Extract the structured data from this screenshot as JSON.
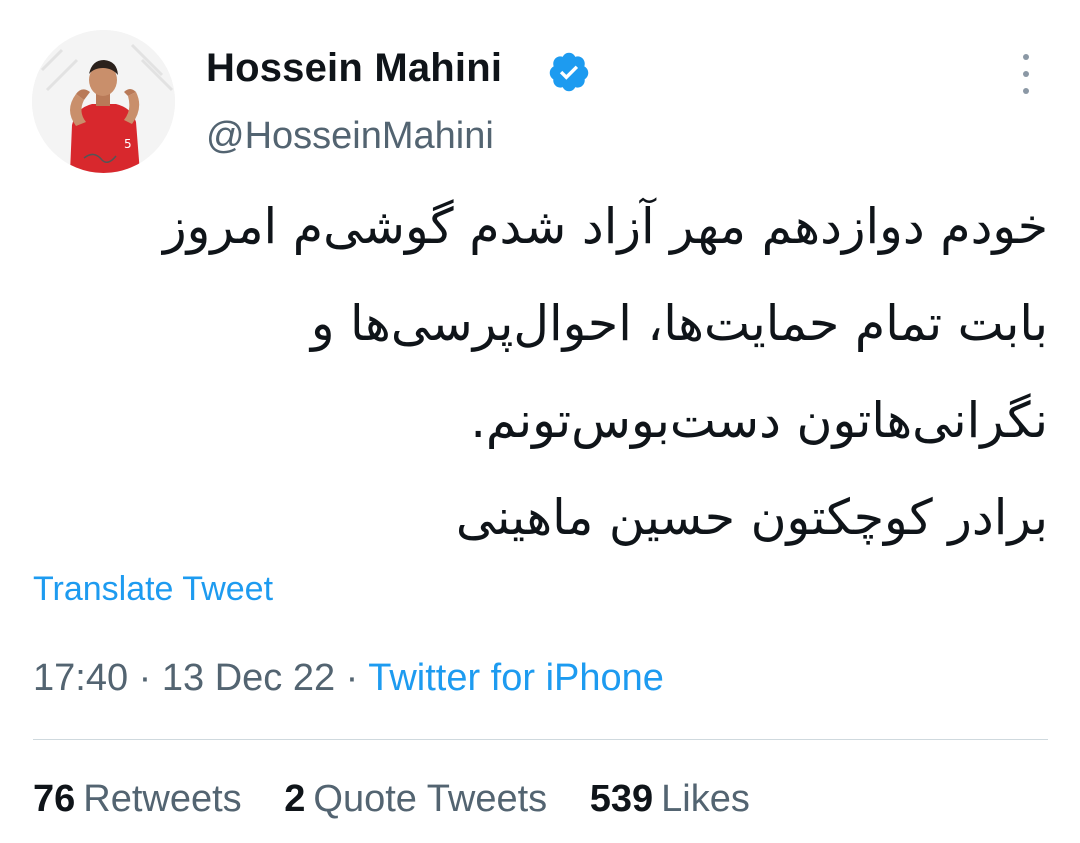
{
  "user": {
    "display_name": "Hossein Mahini",
    "handle": "@HosseinMahini",
    "verified_icon": "verified-badge-icon",
    "avatar_icon": "profile-avatar"
  },
  "tweet": {
    "lines": [
      "خودم دوازدهم مهر آزاد شدم گوشی‌م امروز",
      "بابت تمام حمایت‌ها، احوال‌پرسی‌ها و",
      "نگرانی‌هاتون دست‌بوس‌تونم.",
      "برادر کوچکتون حسین ماهینی"
    ],
    "translate_label": "Translate Tweet"
  },
  "meta": {
    "time": "17:40",
    "separator": "·",
    "date": "13 Dec 22",
    "source": "Twitter for iPhone"
  },
  "stats": {
    "retweets_count": "76",
    "retweets_label": "Retweets",
    "quotes_count": "2",
    "quotes_label": "Quote Tweets",
    "likes_count": "539",
    "likes_label": "Likes"
  },
  "colors": {
    "link": "#1d9bf0",
    "secondary": "#536471",
    "primary": "#0f1419",
    "avatar_shirt": "#d8282d"
  }
}
